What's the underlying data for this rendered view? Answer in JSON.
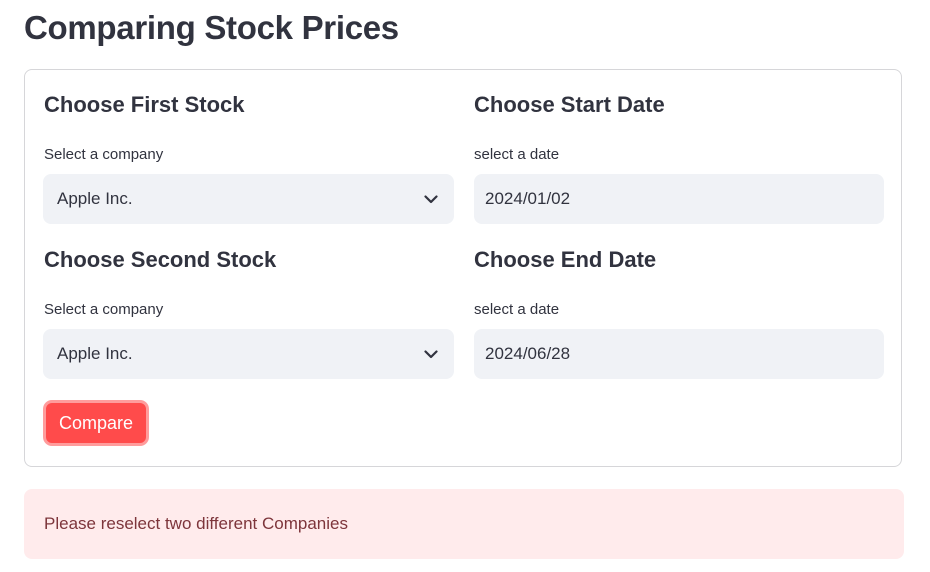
{
  "page": {
    "title": "Comparing Stock Prices"
  },
  "form": {
    "first_stock": {
      "heading": "Choose First Stock",
      "label": "Select a company",
      "value": "Apple Inc."
    },
    "start_date": {
      "heading": "Choose Start Date",
      "label": "select a date",
      "value": "2024/01/02"
    },
    "second_stock": {
      "heading": "Choose Second Stock",
      "label": "Select a company",
      "value": "Apple Inc."
    },
    "end_date": {
      "heading": "Choose End Date",
      "label": "select a date",
      "value": "2024/06/28"
    },
    "compare_label": "Compare"
  },
  "alert": {
    "message": "Please reselect two different Companies"
  },
  "colors": {
    "primary": "#ff4b4b",
    "input_bg": "#f0f2f6",
    "alert_bg": "#ffebec",
    "alert_text": "#7d353b",
    "text": "#31333f"
  },
  "icons": {
    "dropdown": "chevron-down-icon"
  }
}
